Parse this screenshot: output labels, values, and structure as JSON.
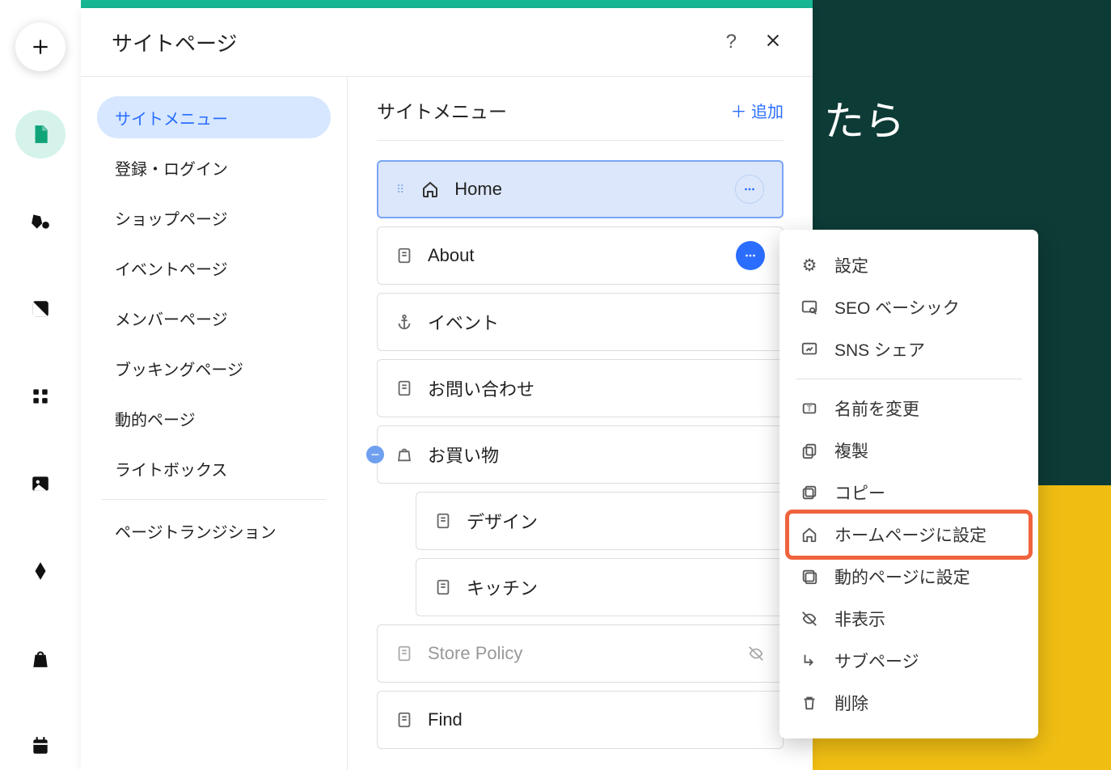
{
  "panel_title": "サイトページ",
  "add_label": "＋ 追加",
  "content_title": "サイトメニュー",
  "bg_text": "たら",
  "categories": [
    "サイトメニュー",
    "登録・ログイン",
    "ショップページ",
    "イベントページ",
    "メンバーページ",
    "ブッキングページ",
    "動的ページ",
    "ライトボックス",
    "ページトランジション"
  ],
  "pages": {
    "home": "Home",
    "about": "About",
    "event": "イベント",
    "contact": "お問い合わせ",
    "shop": "お買い物",
    "design": "デザイン",
    "kitchen": "キッチン",
    "store_policy": "Store Policy",
    "find": "Find"
  },
  "ctx": [
    "設定",
    "SEO ベーシック",
    "SNS シェア",
    "名前を変更",
    "複製",
    "コピー",
    "ホームページに設定",
    "動的ページに設定",
    "非表示",
    "サブページ",
    "削除"
  ]
}
